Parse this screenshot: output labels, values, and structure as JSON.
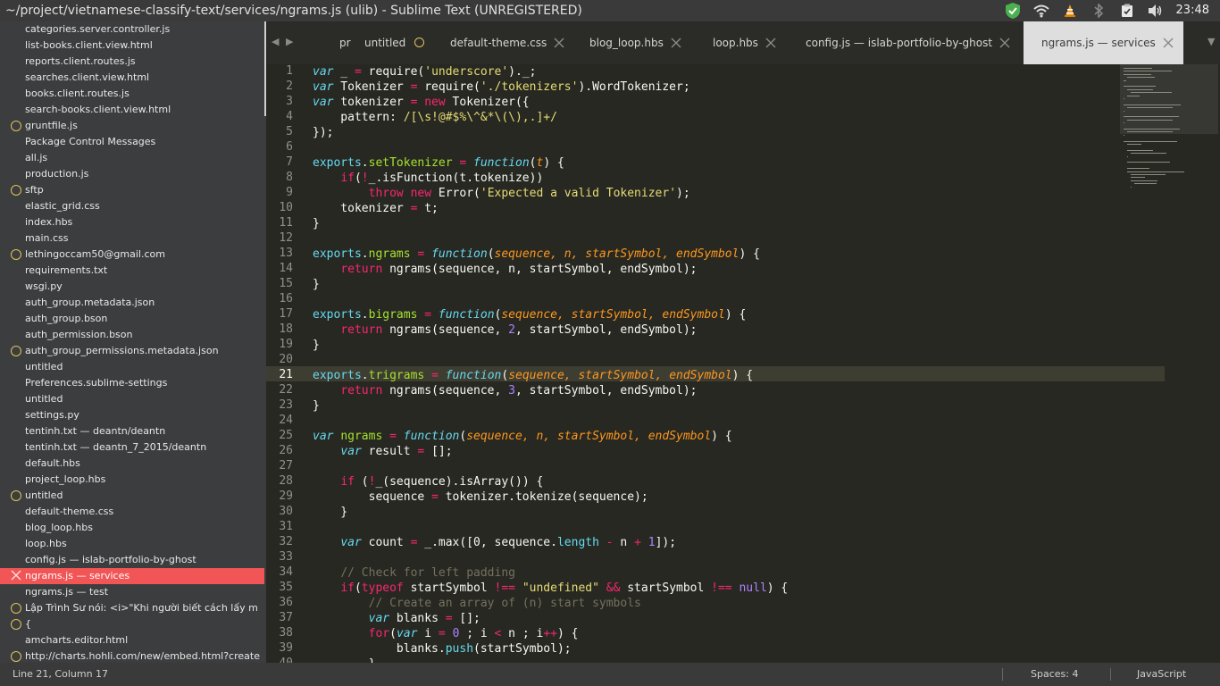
{
  "window": {
    "title": "~/project/vietnamese-classify-text/services/ngrams.js (ulib) - Sublime Text (UNREGISTERED)",
    "clock": "23:48"
  },
  "tray_icons": [
    "shield-check-icon",
    "wifi-icon",
    "vlc-cone-icon",
    "bluetooth-icon",
    "clipboard-check-icon",
    "volume-icon"
  ],
  "sidebar": {
    "items": [
      {
        "label": "categories.server.controller.js",
        "mark": ""
      },
      {
        "label": "list-books.client.view.html",
        "mark": ""
      },
      {
        "label": "reports.client.routes.js",
        "mark": ""
      },
      {
        "label": "searches.client.view.html",
        "mark": ""
      },
      {
        "label": "books.client.routes.js",
        "mark": ""
      },
      {
        "label": "search-books.client.view.html",
        "mark": ""
      },
      {
        "label": "gruntfile.js",
        "mark": "dirty"
      },
      {
        "label": "Package Control Messages",
        "mark": ""
      },
      {
        "label": "all.js",
        "mark": ""
      },
      {
        "label": "production.js",
        "mark": ""
      },
      {
        "label": "sftp",
        "mark": "dirty"
      },
      {
        "label": "elastic_grid.css",
        "mark": ""
      },
      {
        "label": "index.hbs",
        "mark": ""
      },
      {
        "label": "main.css",
        "mark": ""
      },
      {
        "label": "lethingoccam50@gmail.com",
        "mark": "dirty"
      },
      {
        "label": "requirements.txt",
        "mark": ""
      },
      {
        "label": "wsgi.py",
        "mark": ""
      },
      {
        "label": "auth_group.metadata.json",
        "mark": ""
      },
      {
        "label": "auth_group.bson",
        "mark": ""
      },
      {
        "label": "auth_permission.bson",
        "mark": ""
      },
      {
        "label": "auth_group_permissions.metadata.json",
        "mark": "dirty"
      },
      {
        "label": "untitled",
        "mark": ""
      },
      {
        "label": "Preferences.sublime-settings",
        "mark": ""
      },
      {
        "label": "untitled",
        "mark": ""
      },
      {
        "label": "settings.py",
        "mark": ""
      },
      {
        "label": "tentinh.txt — deantn/deantn",
        "mark": ""
      },
      {
        "label": "tentinh.txt — deantn_7_2015/deantn",
        "mark": ""
      },
      {
        "label": "default.hbs",
        "mark": ""
      },
      {
        "label": "project_loop.hbs",
        "mark": ""
      },
      {
        "label": "untitled",
        "mark": "dirty"
      },
      {
        "label": "default-theme.css",
        "mark": ""
      },
      {
        "label": "blog_loop.hbs",
        "mark": ""
      },
      {
        "label": "loop.hbs",
        "mark": ""
      },
      {
        "label": "config.js — islab-portfolio-by-ghost",
        "mark": ""
      },
      {
        "label": "ngrams.js — services",
        "mark": "close",
        "selected": true
      },
      {
        "label": "ngrams.js — test",
        "mark": ""
      },
      {
        "label": "Lập Trình Sư nói: <i>\"Khi người biết cách lấy m",
        "mark": "dirty"
      },
      {
        "label": "{",
        "mark": "dirty"
      },
      {
        "label": "amcharts.editor.html",
        "mark": ""
      },
      {
        "label": "http://charts.hohli.com/new/embed.html?create",
        "mark": "dirty"
      }
    ]
  },
  "tabs": [
    {
      "label": "pr",
      "state": "plain"
    },
    {
      "label": "untitled",
      "state": "dirty"
    },
    {
      "label": "default-theme.css",
      "state": "close"
    },
    {
      "label": "blog_loop.hbs",
      "state": "close"
    },
    {
      "label": "loop.hbs",
      "state": "close"
    },
    {
      "label": "config.js — islab-portfolio-by-ghost",
      "state": "close"
    },
    {
      "label": "ngrams.js — services",
      "state": "close",
      "active": true
    }
  ],
  "editor": {
    "current_line": 21,
    "lines": [
      [
        [
          "kw",
          "var"
        ],
        [
          "t",
          " _ "
        ],
        [
          "op",
          "="
        ],
        [
          "t",
          " require("
        ],
        [
          "st",
          "'underscore'"
        ],
        [
          "t",
          ")._;"
        ]
      ],
      [
        [
          "kw",
          "var"
        ],
        [
          "t",
          " Tokenizer "
        ],
        [
          "op",
          "="
        ],
        [
          "t",
          " require("
        ],
        [
          "st",
          "'./tokenizers'"
        ],
        [
          "t",
          ").WordTokenizer;"
        ]
      ],
      [
        [
          "kw",
          "var"
        ],
        [
          "t",
          " tokenizer "
        ],
        [
          "op",
          "="
        ],
        [
          "t",
          " "
        ],
        [
          "op",
          "new"
        ],
        [
          "t",
          " Tokenizer({"
        ]
      ],
      [
        [
          "t",
          "    pattern: "
        ],
        [
          "st",
          "/[\\s!@#$%\\^&*\\(\\),.]+/"
        ]
      ],
      [
        [
          "t",
          "});"
        ]
      ],
      [],
      [
        [
          "ps",
          "exports"
        ],
        [
          "t",
          "."
        ],
        [
          "fn",
          "setTokenizer"
        ],
        [
          "t",
          " "
        ],
        [
          "op",
          "="
        ],
        [
          "t",
          " "
        ],
        [
          "kw",
          "function"
        ],
        [
          "t",
          "("
        ],
        [
          "pa",
          "t"
        ],
        [
          "t",
          ") {"
        ]
      ],
      [
        [
          "t",
          "    "
        ],
        [
          "op",
          "if"
        ],
        [
          "t",
          "("
        ],
        [
          "op",
          "!"
        ],
        [
          "t",
          "_.isFunction(t.tokenize))"
        ]
      ],
      [
        [
          "t",
          "        "
        ],
        [
          "op",
          "throw"
        ],
        [
          "t",
          " "
        ],
        [
          "op",
          "new"
        ],
        [
          "t",
          " Error("
        ],
        [
          "st",
          "'Expected a valid Tokenizer'"
        ],
        [
          "t",
          ");"
        ]
      ],
      [
        [
          "t",
          "    tokenizer "
        ],
        [
          "op",
          "="
        ],
        [
          "t",
          " t;"
        ]
      ],
      [
        [
          "t",
          "}"
        ]
      ],
      [],
      [
        [
          "ps",
          "exports"
        ],
        [
          "t",
          "."
        ],
        [
          "fn",
          "ngrams"
        ],
        [
          "t",
          " "
        ],
        [
          "op",
          "="
        ],
        [
          "t",
          " "
        ],
        [
          "kw",
          "function"
        ],
        [
          "t",
          "("
        ],
        [
          "pa",
          "sequence, n, startSymbol, endSymbol"
        ],
        [
          "t",
          ") {"
        ]
      ],
      [
        [
          "t",
          "    "
        ],
        [
          "op",
          "return"
        ],
        [
          "t",
          " ngrams(sequence, n, startSymbol, endSymbol);"
        ]
      ],
      [
        [
          "t",
          "}"
        ]
      ],
      [],
      [
        [
          "ps",
          "exports"
        ],
        [
          "t",
          "."
        ],
        [
          "fn",
          "bigrams"
        ],
        [
          "t",
          " "
        ],
        [
          "op",
          "="
        ],
        [
          "t",
          " "
        ],
        [
          "kw",
          "function"
        ],
        [
          "t",
          "("
        ],
        [
          "pa",
          "sequence, startSymbol, endSymbol"
        ],
        [
          "t",
          ") {"
        ]
      ],
      [
        [
          "t",
          "    "
        ],
        [
          "op",
          "return"
        ],
        [
          "t",
          " ngrams(sequence, "
        ],
        [
          "nu",
          "2"
        ],
        [
          "t",
          ", startSymbol, endSymbol);"
        ]
      ],
      [
        [
          "t",
          "}"
        ]
      ],
      [],
      [
        [
          "ps",
          "exports"
        ],
        [
          "t",
          "."
        ],
        [
          "fn",
          "trigrams"
        ],
        [
          "t",
          " "
        ],
        [
          "op",
          "="
        ],
        [
          "t",
          " "
        ],
        [
          "kw",
          "function"
        ],
        [
          "t",
          "("
        ],
        [
          "pa",
          "sequence, startSymbol, endSymbol"
        ],
        [
          "t",
          ") {"
        ]
      ],
      [
        [
          "t",
          "    "
        ],
        [
          "op",
          "return"
        ],
        [
          "t",
          " ngrams(sequence, "
        ],
        [
          "nu",
          "3"
        ],
        [
          "t",
          ", startSymbol, endSymbol);"
        ]
      ],
      [
        [
          "t",
          "}"
        ]
      ],
      [],
      [
        [
          "kw",
          "var"
        ],
        [
          "t",
          " "
        ],
        [
          "fn",
          "ngrams"
        ],
        [
          "t",
          " "
        ],
        [
          "op",
          "="
        ],
        [
          "t",
          " "
        ],
        [
          "kw",
          "function"
        ],
        [
          "t",
          "("
        ],
        [
          "pa",
          "sequence, n, startSymbol, endSymbol"
        ],
        [
          "t",
          ") {"
        ]
      ],
      [
        [
          "t",
          "    "
        ],
        [
          "kw",
          "var"
        ],
        [
          "t",
          " result "
        ],
        [
          "op",
          "="
        ],
        [
          "t",
          " [];"
        ]
      ],
      [],
      [
        [
          "t",
          "    "
        ],
        [
          "op",
          "if"
        ],
        [
          "t",
          " ("
        ],
        [
          "op",
          "!"
        ],
        [
          "t",
          "_(sequence).isArray()) {"
        ]
      ],
      [
        [
          "t",
          "        sequence "
        ],
        [
          "op",
          "="
        ],
        [
          "t",
          " tokenizer.tokenize(sequence);"
        ]
      ],
      [
        [
          "t",
          "    }"
        ]
      ],
      [],
      [
        [
          "t",
          "    "
        ],
        [
          "kw",
          "var"
        ],
        [
          "t",
          " count "
        ],
        [
          "op",
          "="
        ],
        [
          "t",
          " _.max([0, sequence."
        ],
        [
          "ps",
          "length"
        ],
        [
          "t",
          " "
        ],
        [
          "op",
          "-"
        ],
        [
          "t",
          " n "
        ],
        [
          "op",
          "+"
        ],
        [
          "t",
          " "
        ],
        [
          "nu",
          "1"
        ],
        [
          "t",
          "]);"
        ]
      ],
      [],
      [
        [
          "t",
          "    "
        ],
        [
          "co",
          "// Check for left padding"
        ]
      ],
      [
        [
          "t",
          "    "
        ],
        [
          "op",
          "if"
        ],
        [
          "t",
          "("
        ],
        [
          "op",
          "typeof"
        ],
        [
          "t",
          " startSymbol "
        ],
        [
          "op",
          "!=="
        ],
        [
          "t",
          " "
        ],
        [
          "st",
          "\"undefined\""
        ],
        [
          "t",
          " "
        ],
        [
          "op",
          "&&"
        ],
        [
          "t",
          " startSymbol "
        ],
        [
          "op",
          "!=="
        ],
        [
          "t",
          " "
        ],
        [
          "nu",
          "null"
        ],
        [
          "t",
          ") {"
        ]
      ],
      [
        [
          "t",
          "        "
        ],
        [
          "co",
          "// Create an array of (n) start symbols"
        ]
      ],
      [
        [
          "t",
          "        "
        ],
        [
          "kw",
          "var"
        ],
        [
          "t",
          " blanks "
        ],
        [
          "op",
          "="
        ],
        [
          "t",
          " [];"
        ]
      ],
      [
        [
          "t",
          "        "
        ],
        [
          "op",
          "for"
        ],
        [
          "t",
          "("
        ],
        [
          "kw",
          "var"
        ],
        [
          "t",
          " i "
        ],
        [
          "op",
          "="
        ],
        [
          "t",
          " "
        ],
        [
          "nu",
          "0"
        ],
        [
          "t",
          " ; i "
        ],
        [
          "op",
          "<"
        ],
        [
          "t",
          " n ; i"
        ],
        [
          "op",
          "++"
        ],
        [
          "t",
          ") {"
        ]
      ],
      [
        [
          "t",
          "            blanks."
        ],
        [
          "ps",
          "push"
        ],
        [
          "t",
          "(startSymbol);"
        ]
      ],
      [
        [
          "t",
          "        }"
        ]
      ]
    ]
  },
  "status": {
    "position": "Line 21, Column 17",
    "spaces": "Spaces: 4",
    "syntax": "JavaScript"
  },
  "colors": {
    "accent_selected": "#f15555",
    "dirty_marker": "#e6c15a",
    "editor_bg": "#272822"
  }
}
